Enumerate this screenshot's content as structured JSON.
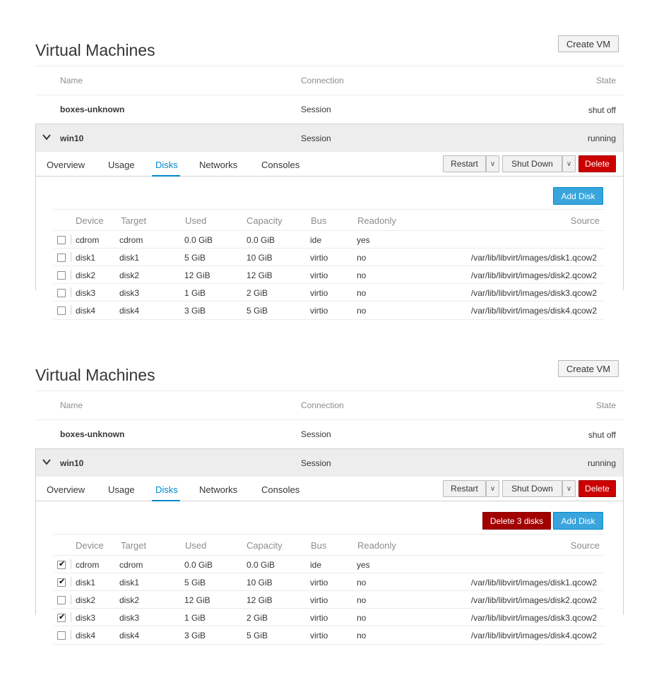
{
  "panels": [
    {
      "title": "Virtual Machines",
      "create_vm_label": "Create VM",
      "columns": {
        "name": "Name",
        "connection": "Connection",
        "state": "State"
      },
      "vm1": {
        "name": "boxes-unknown",
        "connection": "Session",
        "state": "shut off"
      },
      "vm2": {
        "name": "win10",
        "connection": "Session",
        "state": "running"
      },
      "tabs": {
        "overview": "Overview",
        "usage": "Usage",
        "disks": "Disks",
        "networks": "Networks",
        "consoles": "Consoles"
      },
      "actions": {
        "restart": "Restart",
        "shutdown": "Shut Down",
        "delete": "Delete",
        "caret": "∨"
      },
      "add_disk_label": "Add Disk",
      "delete_disks_label": "",
      "disk_columns": {
        "device": "Device",
        "target": "Target",
        "used": "Used",
        "capacity": "Capacity",
        "bus": "Bus",
        "readonly": "Readonly",
        "source": "Source"
      },
      "disks": [
        {
          "device": "cdrom",
          "target": "cdrom",
          "used": "0.0 GiB",
          "capacity": "0.0 GiB",
          "bus": "ide",
          "readonly": "yes",
          "source": "",
          "checked": false
        },
        {
          "device": "disk1",
          "target": "disk1",
          "used": "5 GiB",
          "capacity": "10 GiB",
          "bus": "virtio",
          "readonly": "no",
          "source": "/var/lib/libvirt/images/disk1.qcow2",
          "checked": false
        },
        {
          "device": "disk2",
          "target": "disk2",
          "used": "12 GiB",
          "capacity": "12 GiB",
          "bus": "virtio",
          "readonly": "no",
          "source": "/var/lib/libvirt/images/disk2.qcow2",
          "checked": false
        },
        {
          "device": "disk3",
          "target": "disk3",
          "used": "1 GiB",
          "capacity": "2 GiB",
          "bus": "virtio",
          "readonly": "no",
          "source": "/var/lib/libvirt/images/disk3.qcow2",
          "checked": false
        },
        {
          "device": "disk4",
          "target": "disk4",
          "used": "3 GiB",
          "capacity": "5 GiB",
          "bus": "virtio",
          "readonly": "no",
          "source": "/var/lib/libvirt/images/disk4.qcow2",
          "checked": false
        }
      ]
    },
    {
      "title": "Virtual Machines",
      "create_vm_label": "Create VM",
      "columns": {
        "name": "Name",
        "connection": "Connection",
        "state": "State"
      },
      "vm1": {
        "name": "boxes-unknown",
        "connection": "Session",
        "state": "shut off"
      },
      "vm2": {
        "name": "win10",
        "connection": "Session",
        "state": "running"
      },
      "tabs": {
        "overview": "Overview",
        "usage": "Usage",
        "disks": "Disks",
        "networks": "Networks",
        "consoles": "Consoles"
      },
      "actions": {
        "restart": "Restart",
        "shutdown": "Shut Down",
        "delete": "Delete",
        "caret": "∨"
      },
      "add_disk_label": "Add Disk",
      "delete_disks_label": "Delete 3 disks",
      "disk_columns": {
        "device": "Device",
        "target": "Target",
        "used": "Used",
        "capacity": "Capacity",
        "bus": "Bus",
        "readonly": "Readonly",
        "source": "Source"
      },
      "disks": [
        {
          "device": "cdrom",
          "target": "cdrom",
          "used": "0.0 GiB",
          "capacity": "0.0 GiB",
          "bus": "ide",
          "readonly": "yes",
          "source": "",
          "checked": true
        },
        {
          "device": "disk1",
          "target": "disk1",
          "used": "5 GiB",
          "capacity": "10 GiB",
          "bus": "virtio",
          "readonly": "no",
          "source": "/var/lib/libvirt/images/disk1.qcow2",
          "checked": true
        },
        {
          "device": "disk2",
          "target": "disk2",
          "used": "12 GiB",
          "capacity": "12 GiB",
          "bus": "virtio",
          "readonly": "no",
          "source": "/var/lib/libvirt/images/disk2.qcow2",
          "checked": false
        },
        {
          "device": "disk3",
          "target": "disk3",
          "used": "1 GiB",
          "capacity": "2 GiB",
          "bus": "virtio",
          "readonly": "no",
          "source": "/var/lib/libvirt/images/disk3.qcow2",
          "checked": true
        },
        {
          "device": "disk4",
          "target": "disk4",
          "used": "3 GiB",
          "capacity": "5 GiB",
          "bus": "virtio",
          "readonly": "no",
          "source": "/var/lib/libvirt/images/disk4.qcow2",
          "checked": false
        }
      ]
    }
  ]
}
